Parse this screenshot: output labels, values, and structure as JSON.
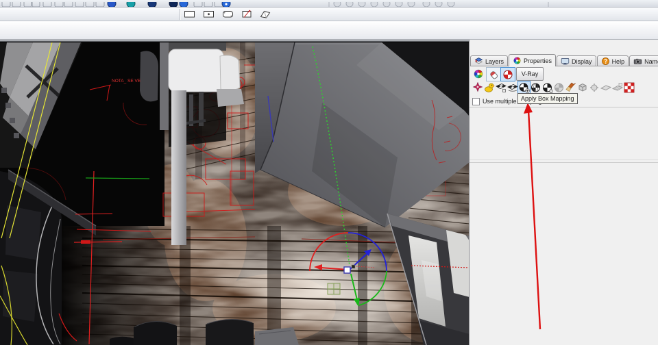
{
  "top_toolbar": {
    "icon_names": [
      "gray-button-icons-clipped",
      "blue-sphere-icon",
      "teal-sphere-icon",
      "navy-sphere-icon",
      "navy-sphere-icon-2",
      "blue-sphere-icon-2",
      "help-sphere-icon",
      "gray-button-group-right"
    ]
  },
  "rect_toolbar": {
    "icons": [
      "rectangle-tool-icon",
      "rectangle-center-point-tool-icon",
      "rounded-rectangle-tool-icon",
      "rectangle-3point-tool-icon",
      "plane-surface-tool-icon"
    ]
  },
  "side_panel": {
    "tabs": [
      {
        "label": "Layers",
        "icon": "layers-icon",
        "active": false
      },
      {
        "label": "Properties",
        "icon": "color-wheel-icon",
        "active": true
      },
      {
        "label": "Display",
        "icon": "monitor-icon",
        "active": false
      },
      {
        "label": "Help",
        "icon": "help-icon",
        "active": false
      },
      {
        "label": "Named Views",
        "icon": "camera-icon",
        "active": false
      }
    ],
    "object_buttons": [
      {
        "icon": "color-wheel-icon",
        "selected": false
      },
      {
        "icon": "material-icon",
        "selected": false
      },
      {
        "icon": "texture-mapping-icon",
        "selected": true
      }
    ],
    "vray_button": {
      "label": "V-Ray"
    },
    "mapping_toolbar": {
      "selected_index": 4,
      "icons": [
        "show-mapping-widget-icon",
        "mapping-duck-icon",
        "planar-mapping-icon",
        "surface-mapping-icon",
        "box-mapping-icon",
        "spherical-mapping-icon",
        "cylindrical-mapping-icon",
        "custom-mapping-icon-disabled",
        "match-mapping-brush-icon",
        "box-uv-icon-disabled",
        "mapping-widget-icon-disabled",
        "planar-uv-icon-disabled",
        "unwrap-icon-disabled",
        "checker-texture-icon"
      ]
    },
    "multiple_mapping_checkbox": {
      "label": "Use multiple mapping",
      "checked": false
    },
    "tooltip": {
      "text": "Apply Box Mapping"
    }
  },
  "viewport": {
    "annotation_text": "NOTA_ SE VE",
    "gumball_axis_colors": {
      "x": "#e02020",
      "y": "#18b018",
      "z": "#2222d8"
    }
  },
  "callout": {
    "arrow_color": "#dd1111"
  },
  "colors": {
    "panel_bg": "#f0f0f0",
    "selection_bg": "#cfe4f8",
    "selection_border": "#4a90d2",
    "cad_red": "#d01818",
    "yellow_line": "#e6e636",
    "green_dotted": "#2ed22e"
  }
}
